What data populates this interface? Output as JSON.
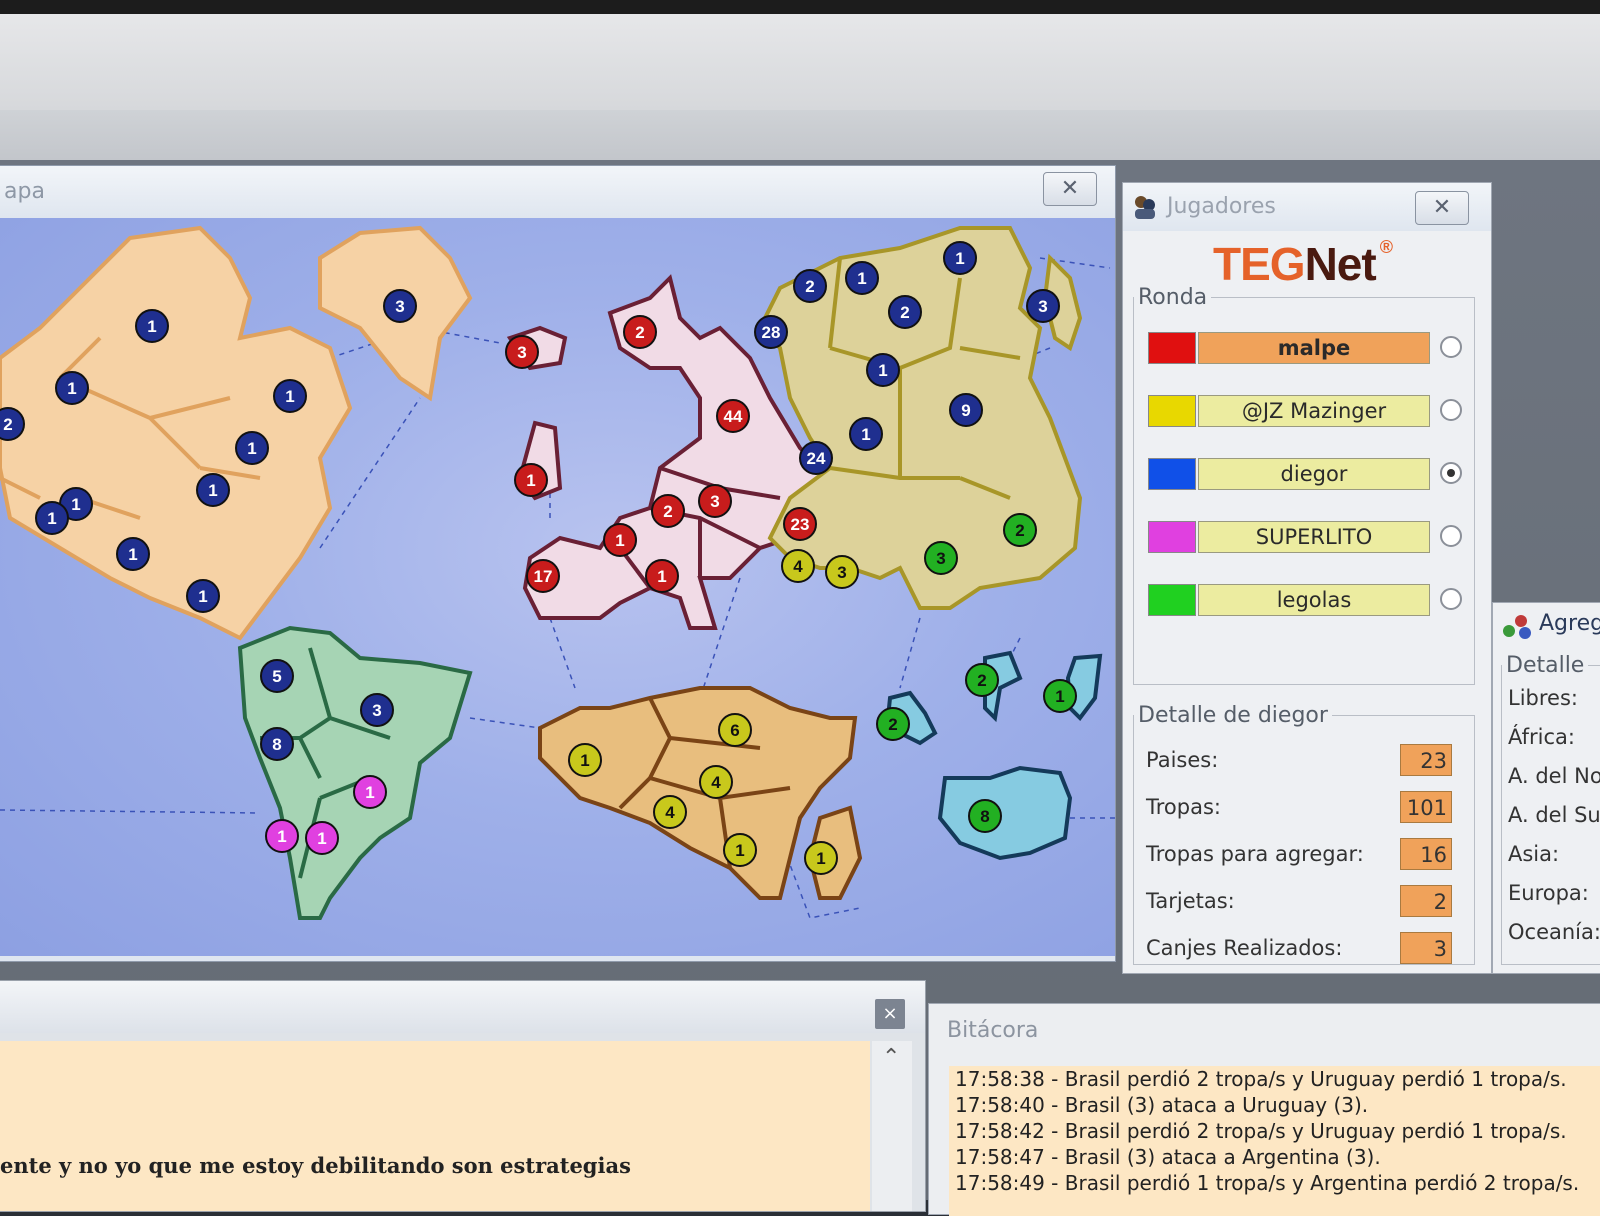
{
  "map_window": {
    "title": "apa",
    "close_icon": "close-icon",
    "continent_colors": {
      "north_america": "#f6d2a5",
      "south_america": "#a6d4b4",
      "europe": "#f1dbe6",
      "asia": "#ddd29a",
      "africa": "#e8be7e",
      "oceania": "#86cbe1"
    },
    "armies": [
      {
        "n": "1",
        "color": "#1f2f8f"
      },
      {
        "n": "1",
        "color": "#1f2f8f"
      },
      {
        "n": "1",
        "color": "#1f2f8f"
      },
      {
        "n": "2",
        "color": "#1f2f8f"
      },
      {
        "n": "1",
        "color": "#1f2f8f"
      },
      {
        "n": "1",
        "color": "#1f2f8f"
      },
      {
        "n": "1",
        "color": "#1f2f8f"
      },
      {
        "n": "1",
        "color": "#1f2f8f"
      },
      {
        "n": "1",
        "color": "#1f2f8f"
      },
      {
        "n": "1",
        "color": "#1f2f8f"
      },
      {
        "n": "3",
        "color": "#1f2f8f"
      },
      {
        "n": "5",
        "color": "#1f2f8f"
      },
      {
        "n": "3",
        "color": "#1f2f8f"
      },
      {
        "n": "8",
        "color": "#1f2f8f"
      },
      {
        "n": "1",
        "color": "#e040e0"
      },
      {
        "n": "1",
        "color": "#e040e0"
      },
      {
        "n": "1",
        "color": "#e040e0"
      },
      {
        "n": "3",
        "color": "#c81c1c"
      },
      {
        "n": "2",
        "color": "#c81c1c"
      },
      {
        "n": "1",
        "color": "#c81c1c"
      },
      {
        "n": "44",
        "color": "#c81c1c"
      },
      {
        "n": "2",
        "color": "#c81c1c"
      },
      {
        "n": "3",
        "color": "#c81c1c"
      },
      {
        "n": "1",
        "color": "#c81c1c"
      },
      {
        "n": "17",
        "color": "#c81c1c"
      },
      {
        "n": "1",
        "color": "#c81c1c"
      },
      {
        "n": "23",
        "color": "#c81c1c"
      },
      {
        "n": "2",
        "color": "#1f2f8f"
      },
      {
        "n": "1",
        "color": "#1f2f8f"
      },
      {
        "n": "1",
        "color": "#1f2f8f"
      },
      {
        "n": "28",
        "color": "#1f2f8f"
      },
      {
        "n": "2",
        "color": "#1f2f8f"
      },
      {
        "n": "3",
        "color": "#1f2f8f"
      },
      {
        "n": "1",
        "color": "#1f2f8f"
      },
      {
        "n": "9",
        "color": "#1f2f8f"
      },
      {
        "n": "1",
        "color": "#1f2f8f"
      },
      {
        "n": "24",
        "color": "#1f2f8f"
      },
      {
        "n": "4",
        "color": "#c8c81c"
      },
      {
        "n": "3",
        "color": "#c8c81c"
      },
      {
        "n": "3",
        "color": "#22b022"
      },
      {
        "n": "2",
        "color": "#22b022"
      },
      {
        "n": "6",
        "color": "#c8c81c"
      },
      {
        "n": "1",
        "color": "#c8c81c"
      },
      {
        "n": "4",
        "color": "#c8c81c"
      },
      {
        "n": "4",
        "color": "#c8c81c"
      },
      {
        "n": "1",
        "color": "#c8c81c"
      },
      {
        "n": "1",
        "color": "#c8c81c"
      },
      {
        "n": "2",
        "color": "#22b022"
      },
      {
        "n": "2",
        "color": "#22b022"
      },
      {
        "n": "1",
        "color": "#22b022"
      },
      {
        "n": "8",
        "color": "#22b022"
      }
    ]
  },
  "players_window": {
    "title": "Jugadores",
    "logo_teg": "TEG",
    "logo_net": "Net",
    "logo_mark": "®",
    "round_legend": "Ronda",
    "players": [
      {
        "name": "malpe",
        "color": "#e01010",
        "bg": "#f0a25a",
        "active": false
      },
      {
        "name": "@JZ Mazinger",
        "color": "#e8d800",
        "bg": "#ececa0",
        "active": false
      },
      {
        "name": "diegor",
        "color": "#1050e8",
        "bg": "#ececa0",
        "active": true
      },
      {
        "name": "SUPERLITO",
        "color": "#e040e0",
        "bg": "#ececa0",
        "active": false
      },
      {
        "name": "legolas",
        "color": "#20d020",
        "bg": "#ececa0",
        "active": false
      }
    ],
    "detail_legend": "Detalle de diegor",
    "details": [
      {
        "label": "Paises:",
        "value": "23"
      },
      {
        "label": "Tropas:",
        "value": "101"
      },
      {
        "label": "Tropas para agregar:",
        "value": "16"
      },
      {
        "label": "Tarjetas:",
        "value": "2"
      },
      {
        "label": "Canjes Realizados:",
        "value": "3"
      }
    ]
  },
  "add_window": {
    "title": "Agreg",
    "legend": "Detalle",
    "items": [
      "Libres:",
      "África:",
      "A. del No",
      "A. del Sur",
      "Asia:",
      "Europa:",
      "Oceanía:"
    ]
  },
  "chat_window": {
    "close_label": "×",
    "scroll_up": "⌃",
    "visible_line": "ente y no yo que me estoy debilitando son estrategias"
  },
  "log_window": {
    "title": "Bitácora",
    "lines": [
      "17:58:38 - Brasil perdió 2 tropa/s y Uruguay perdió 1 tropa/s.",
      "17:58:40 - Brasil (3) ataca a Uruguay (3).",
      "17:58:42 - Brasil perdió 2 tropa/s y Uruguay perdió 1 tropa/s.",
      "17:58:47 - Brasil (3) ataca a Argentina (3).",
      "17:58:49 - Brasil perdió 1 tropa/s y Argentina perdió 2 tropa/s."
    ]
  }
}
